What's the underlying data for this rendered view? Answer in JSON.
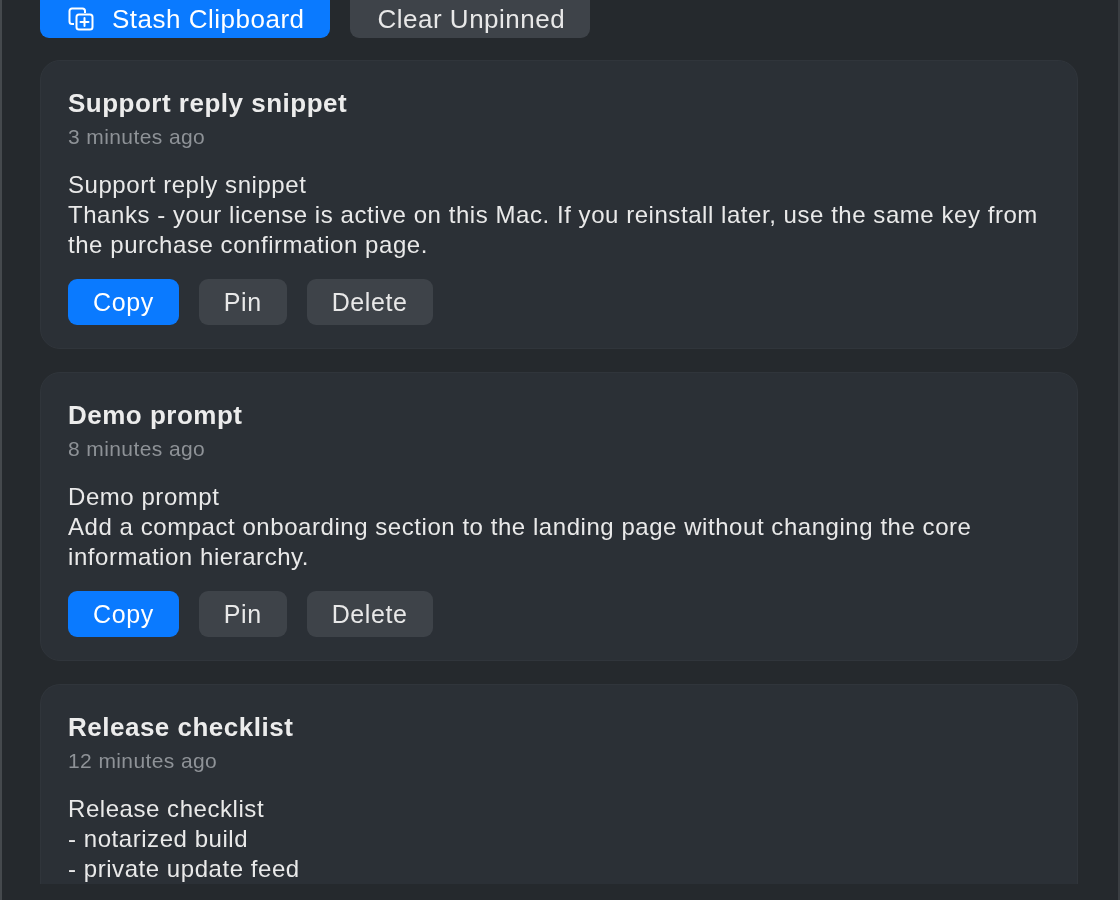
{
  "toolbar": {
    "buttons": [
      {
        "label": "Stash Clipboard",
        "kind": "primary"
      },
      {
        "label": "Clear Unpinned",
        "kind": "secondary"
      }
    ]
  },
  "clips": [
    {
      "title": "Support reply snippet",
      "time": "3 minutes ago",
      "body": "Support reply snippet\nThanks - your license is active on this Mac. If you reinstall later, use the same key from the purchase confirmation page.",
      "actions": [
        {
          "label": "Copy",
          "kind": "primary"
        },
        {
          "label": "Pin",
          "kind": "secondary"
        },
        {
          "label": "Delete",
          "kind": "secondary"
        }
      ]
    },
    {
      "title": "Demo prompt",
      "time": "8 minutes ago",
      "body": "Demo prompt\nAdd a compact onboarding section to the landing page without changing the core information hierarchy.",
      "actions": [
        {
          "label": "Copy",
          "kind": "primary"
        },
        {
          "label": "Pin",
          "kind": "secondary"
        },
        {
          "label": "Delete",
          "kind": "secondary"
        }
      ]
    },
    {
      "title": "Release checklist",
      "time": "12 minutes ago",
      "body": "Release checklist\n- notarized build\n- private update feed"
    }
  ]
}
